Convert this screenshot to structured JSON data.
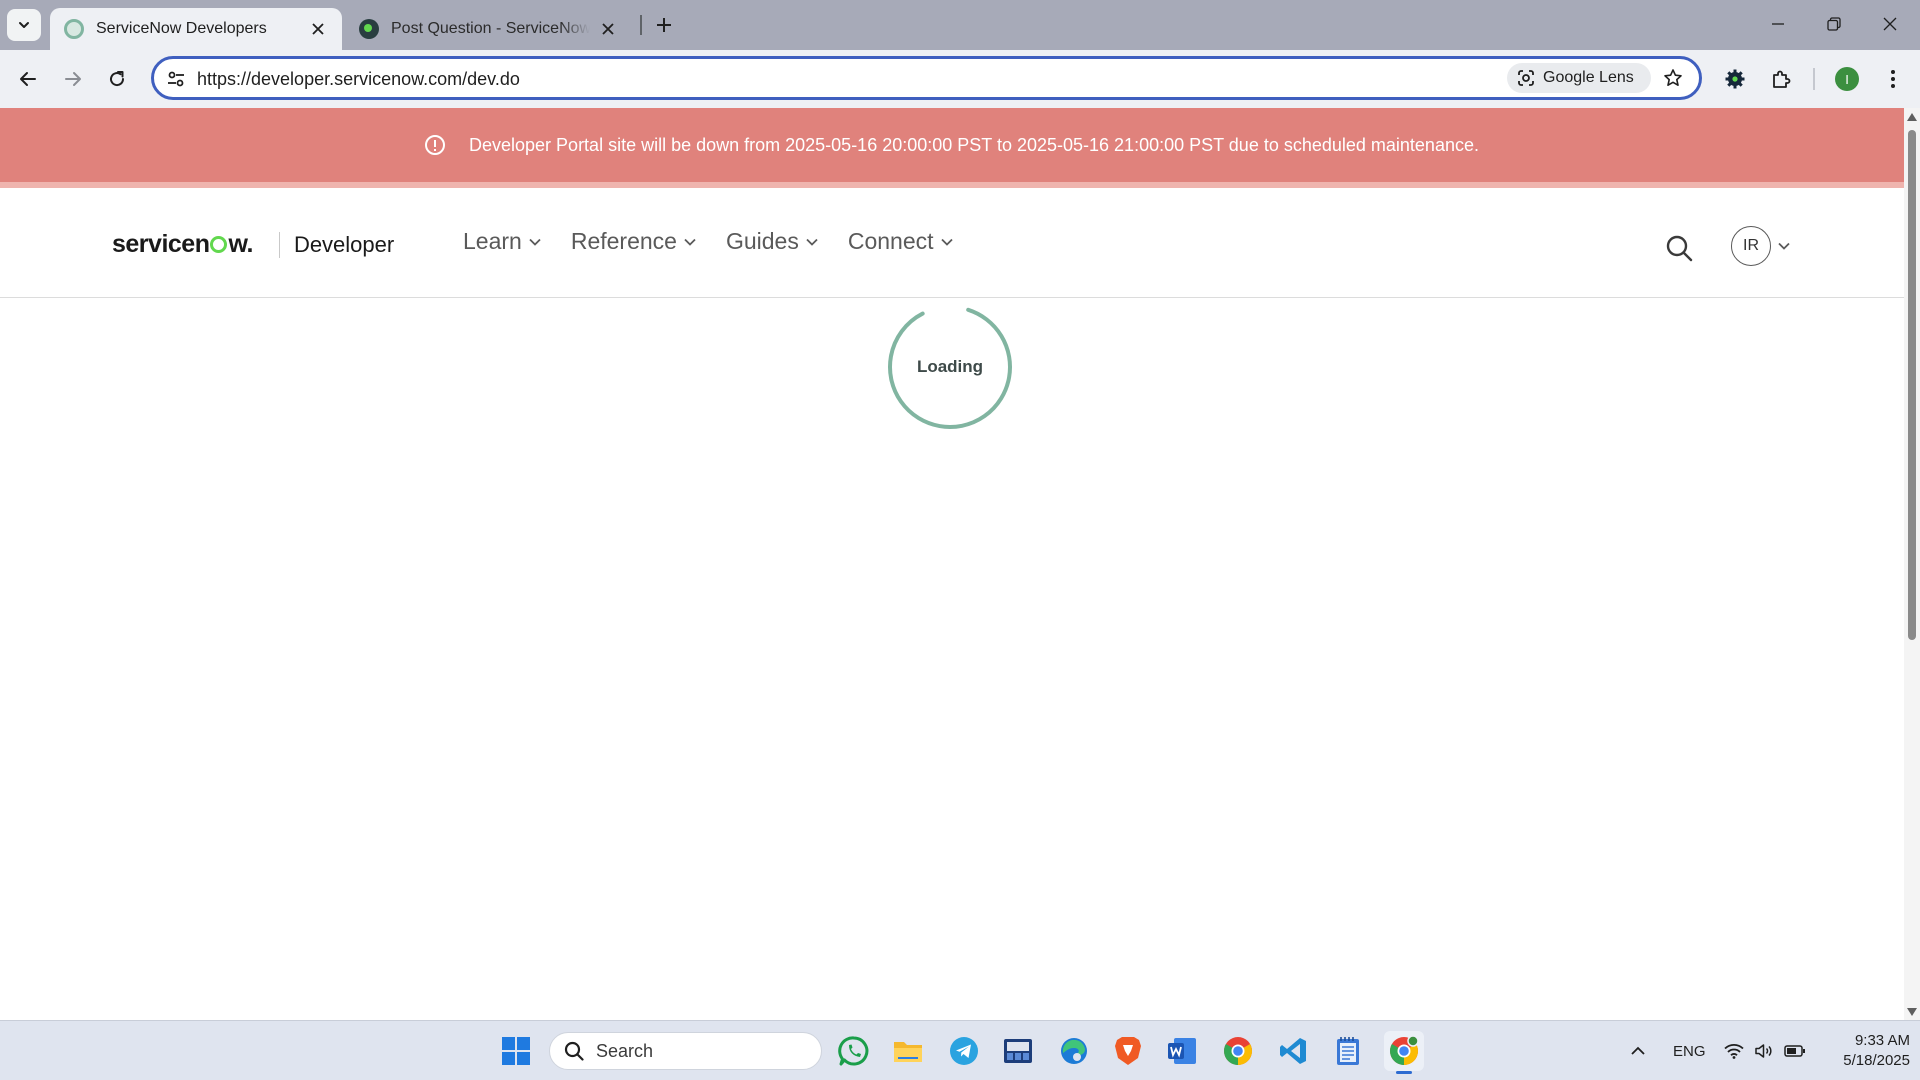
{
  "browser": {
    "tabs": [
      {
        "title": "ServiceNow Developers",
        "active": true
      },
      {
        "title": "Post Question - ServiceNow Community",
        "active": false
      }
    ],
    "url": "https://developer.servicenow.com/dev.do",
    "lens_label": "Google Lens",
    "profile_initial": "I"
  },
  "banner": {
    "message": "Developer Portal site will be down from 2025-05-16 20:00:00 PST to 2025-05-16 21:00:00 PST due to scheduled maintenance."
  },
  "header": {
    "logo_pre": "servicen",
    "logo_post": "w.",
    "brand_section": "Developer",
    "nav": [
      {
        "label": "Learn"
      },
      {
        "label": "Reference"
      },
      {
        "label": "Guides"
      },
      {
        "label": "Connect"
      }
    ],
    "user_initials": "IR"
  },
  "main": {
    "loading_text": "Loading"
  },
  "taskbar": {
    "search_placeholder": "Search",
    "language": "ENG",
    "time": "9:33 AM",
    "date": "5/18/2025"
  },
  "colors": {
    "banner_bg": "#e0827c",
    "brand_green": "#62d84e",
    "loader_ring": "#81b5a1",
    "omnibox_focus": "#3f5fbf"
  }
}
